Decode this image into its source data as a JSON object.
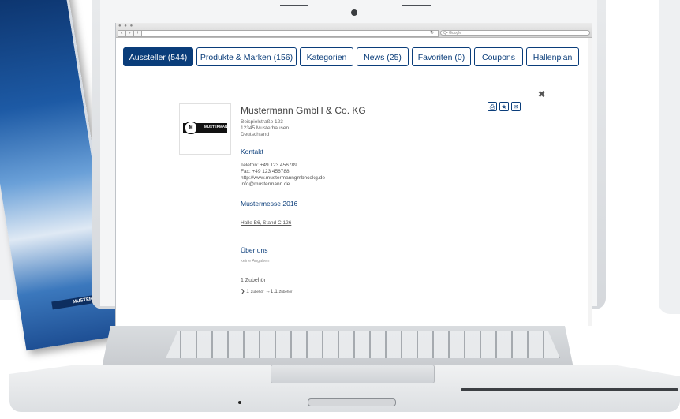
{
  "tabs": [
    {
      "label": "Aussteller (544)",
      "active": true
    },
    {
      "label": "Produkte & Marken (156)",
      "active": false
    },
    {
      "label": "Kategorien",
      "active": false
    },
    {
      "label": "News (25)",
      "active": false
    },
    {
      "label": "Favoriten (0)",
      "active": false
    },
    {
      "label": "Coupons",
      "active": false
    },
    {
      "label": "Hallenplan",
      "active": false
    }
  ],
  "browser": {
    "search_placeholder": "Q• Google"
  },
  "exhibitor": {
    "logo_text": "MUSTERMANN",
    "name": "Mustermann GmbH & Co. KG",
    "address": [
      "Beispielstraße 123",
      "12345 Musterhausen",
      "Deutschland"
    ],
    "contact_heading": "Kontakt",
    "contact": [
      "Telefon: +49 123 456789",
      "Fax: +49 123 456788",
      "http://www.mustermanngmbhcokg.de",
      "info@mustermann.de"
    ],
    "fair_heading": "Mustermesse 2016",
    "stand": "Halle B6, Stand C.126",
    "about_heading": "Über uns",
    "about_text": "keine Angaben",
    "accessories_heading": "1 Zubehör",
    "accessories_path": {
      "first_num": "1",
      "first_label": "Zubehör",
      "second_num": "1.1",
      "second_label": "Zubehör"
    }
  },
  "brochure_strip": "MUSTERMANN",
  "colors": {
    "accent": "#0a3d7a"
  }
}
